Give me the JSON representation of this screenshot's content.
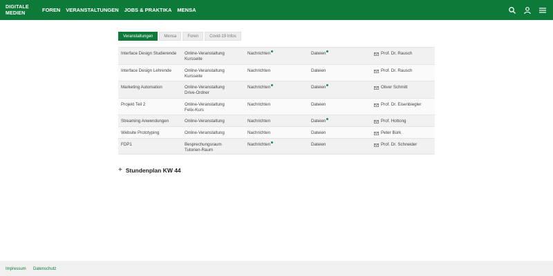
{
  "header": {
    "logo_line1": "DIGITALE",
    "logo_line2": "MEDIEN",
    "nav": [
      "FOREN",
      "VERANSTALTUNGEN",
      "JOBS & PRAKTIKA",
      "MENSA"
    ],
    "icons": [
      "search-icon",
      "user-icon",
      "menu-icon"
    ]
  },
  "tabs": [
    "Veranstaltungen",
    "Mensa",
    "Foren",
    "Covid-19 Infos"
  ],
  "active_tab": "Veranstaltungen",
  "rows": [
    {
      "name": "Interface Design Studierende",
      "online1": "Online-Veranstaltung",
      "online2": "Kursseite",
      "news": "Nachrichten",
      "news_new": true,
      "files": "Dateien",
      "files_new": true,
      "person": "Prof. Dr. Rausch"
    },
    {
      "name": "Interface Design Lehrende",
      "online1": "Online-Veranstaltung",
      "online2": "Kursseite",
      "news": "Nachrichten",
      "news_new": false,
      "files": "Dateien",
      "files_new": false,
      "person": "Prof. Dr. Rausch"
    },
    {
      "name": "Marketing Automation",
      "online1": "Online-Veranstaltung",
      "online2": "Drive-Ordner",
      "news": "Nachrichten",
      "news_new": true,
      "files": "Dateien",
      "files_new": true,
      "person": "Oliver Schmitt"
    },
    {
      "name": "Projekt Teil 2",
      "online1": "Online-Veranstaltung",
      "online2": "Felix-Kurs",
      "news": "Nachrichten",
      "news_new": false,
      "files": "Dateien",
      "files_new": false,
      "person": "Prof. Dr. Eisenbiegler"
    },
    {
      "name": "Streaming Anwendungen",
      "online1": "Online-Veranstaltung",
      "online2": "",
      "news": "Nachrichten",
      "news_new": false,
      "files": "Dateien",
      "files_new": true,
      "person": "Prof. Hottong"
    },
    {
      "name": "Website Prototyping",
      "online1": "Online-Veranstaltung",
      "online2": "",
      "news": "Nachrichten",
      "news_new": false,
      "files": "Dateien",
      "files_new": false,
      "person": "Peter Bürk"
    },
    {
      "name": "FDP1",
      "online1": "Besprechungsraum",
      "online2": "Tutorien-Raum",
      "news": "Nachrichten",
      "news_new": true,
      "files": "Dateien",
      "files_new": false,
      "person": "Prof. Dr. Schneider"
    }
  ],
  "schedule": {
    "plus": "+",
    "label": "Stundenplan KW 44"
  },
  "footer": {
    "impressum": "Impressum",
    "datenschutz": "Datenschutz"
  },
  "colors": {
    "brand": "#0d7a3a",
    "new_dot": "#1a8a5a"
  }
}
